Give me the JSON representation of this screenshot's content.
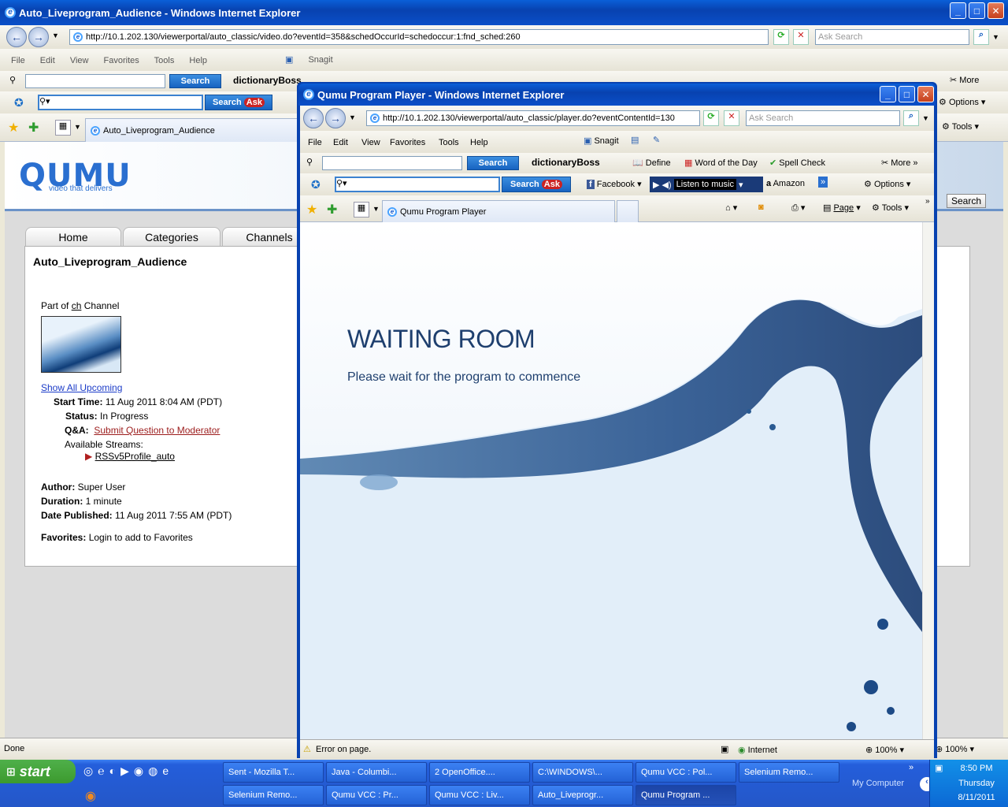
{
  "main_window": {
    "title": "Auto_Liveprogram_Audience - Windows Internet Explorer",
    "url": "http://10.1.202.130/viewerportal/auto_classic/video.do?eventId=358&schedOccurId=schedoccur:1:fnd_sched:260",
    "search_placeholder": "Ask Search",
    "menu": [
      "File",
      "Edit",
      "View",
      "Favorites",
      "Tools",
      "Help"
    ],
    "snagit": "Snagit",
    "search_btn": "Search",
    "dictionary": "dictionaryBoss",
    "more": "More",
    "options": "Options",
    "tools": "Tools",
    "tab": "Auto_Liveprogram_Audience",
    "status": "Done",
    "zoom": "100%"
  },
  "portal": {
    "logo": "QUMU",
    "tagline": "video that delivers",
    "search_btn": "Search",
    "nav": [
      "Home",
      "Categories",
      "Channels"
    ],
    "title": "Auto_Liveprogram_Audience",
    "part_of": "Part of",
    "channel_link": "ch",
    "channel_word": "Channel",
    "show_upcoming": "Show All Upcoming",
    "start_time_label": "Start Time:",
    "start_time": "11 Aug 2011 8:04 AM (PDT)",
    "status_label": "Status:",
    "status": "In Progress",
    "qa_label": "Q&A:",
    "qa_link": "Submit Question to Moderator",
    "streams_label": "Available Streams:",
    "stream": "RSSv5Profile_auto",
    "author_label": "Author:",
    "author": "Super User",
    "duration_label": "Duration:",
    "duration": "1 minute",
    "published_label": "Date Published:",
    "published": "11 Aug 2011 7:55 AM (PDT)",
    "favorites_label": "Favorites:",
    "favorites": "Login to add to Favorites"
  },
  "popup": {
    "title": "Qumu Program Player - Windows Internet Explorer",
    "url": "http://10.1.202.130/viewerportal/auto_classic/player.do?eventContentId=130",
    "search_placeholder": "Ask Search",
    "menu": [
      "File",
      "Edit",
      "View",
      "Favorites",
      "Tools",
      "Help"
    ],
    "snagit": "Snagit",
    "search_btn": "Search",
    "dictionary": "dictionaryBoss",
    "define": "Define",
    "word_of_day": "Word of the Day",
    "spell_check": "Spell Check",
    "more": "More",
    "facebook": "Facebook",
    "listen": "Listen to music",
    "amazon": "Amazon",
    "options": "Options",
    "tab": "Qumu Program Player",
    "page": "Page",
    "tools": "Tools",
    "waiting_title": "WAITING ROOM",
    "waiting_sub": "Please wait for the program to commence",
    "status": "Error on page.",
    "zone": "Internet",
    "zoom": "100%"
  },
  "taskbar": {
    "start": "start",
    "row1": [
      "Sent - Mozilla T...",
      "Java - Columbi...",
      "2 OpenOffice....",
      "C:\\WINDOWS\\...",
      "Qumu VCC : Pol...",
      "Selenium Remo..."
    ],
    "row2": [
      "Selenium Remo...",
      "Qumu VCC : Pr...",
      "Qumu VCC : Liv...",
      "Auto_Liveprogr...",
      "Qumu Program ..."
    ],
    "my_computer": "My Computer",
    "time": "8:50 PM",
    "day": "Thursday",
    "date": "8/11/2011"
  },
  "colors": {
    "xp_blue": "#0842b0",
    "start_green": "#3c9a2e",
    "link": "#1c3cc8",
    "qa_link": "#9c1c1c",
    "stream_arrow": "#b02020"
  }
}
